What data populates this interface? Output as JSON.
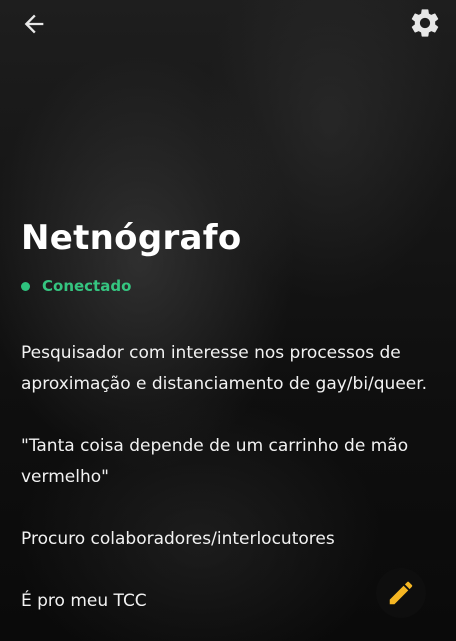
{
  "profile": {
    "name": "Netnógrafo",
    "status": "Conectado",
    "status_color": "#35c580"
  },
  "bio": {
    "paragraphs": [
      "Pesquisador com interesse nos processos de aproximação e distanciamento de gay/bi/queer.",
      "\"Tanta coisa depende de um carrinho de mão vermelho\"",
      "Procuro colaboradores/interlocutores",
      "É pro meu TCC"
    ]
  },
  "icons": {
    "back": "arrow-left-icon",
    "settings": "gear-icon",
    "edit": "pencil-icon"
  },
  "colors": {
    "accent": "#f5b623",
    "online": "#2ec27e",
    "text": "#ffffff"
  }
}
